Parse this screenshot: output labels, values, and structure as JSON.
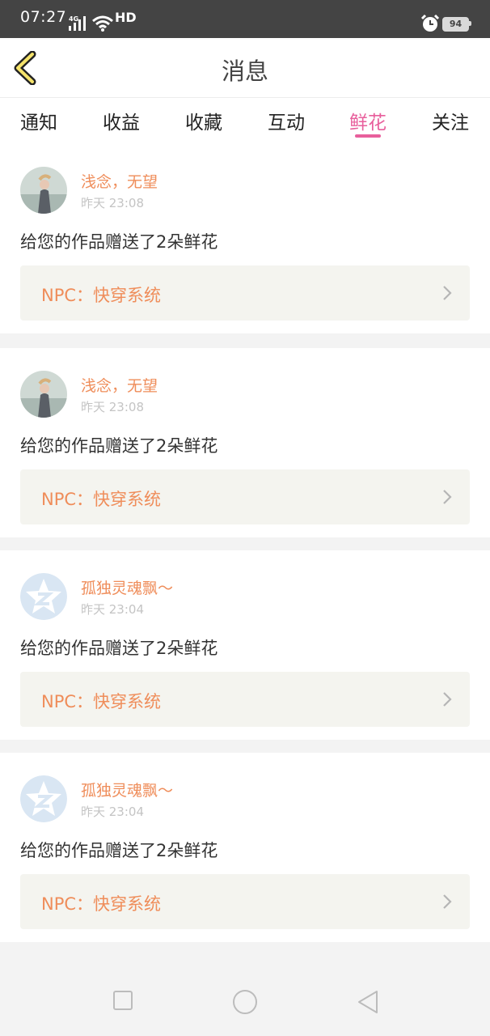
{
  "status_bar": {
    "time": "07:27",
    "network": "4G",
    "hd": "HD",
    "battery": "94"
  },
  "header": {
    "title": "消息",
    "back_icon": "chevron-left-icon"
  },
  "tabs": [
    {
      "label": "通知",
      "active": false
    },
    {
      "label": "收益",
      "active": false
    },
    {
      "label": "收藏",
      "active": false
    },
    {
      "label": "互动",
      "active": false
    },
    {
      "label": "鲜花",
      "active": true
    },
    {
      "label": "关注",
      "active": false
    }
  ],
  "messages": [
    {
      "user": "浅念，无望",
      "time": "昨天 23:08",
      "avatar": "photo-avatar",
      "text": "给您的作品赠送了2朵鲜花",
      "work": "NPC：快穿系统"
    },
    {
      "user": "浅念，无望",
      "time": "昨天 23:08",
      "avatar": "photo-avatar",
      "text": "给您的作品赠送了2朵鲜花",
      "work": "NPC：快穿系统"
    },
    {
      "user": "孤独灵魂飘〜",
      "time": "昨天 23:04",
      "avatar": "default-star-avatar",
      "text": "给您的作品赠送了2朵鲜花",
      "work": "NPC：快穿系统"
    },
    {
      "user": "孤独灵魂飘〜",
      "time": "昨天 23:04",
      "avatar": "default-star-avatar",
      "text": "给您的作品赠送了2朵鲜花",
      "work": "NPC：快穿系统"
    }
  ],
  "colors": {
    "accent": "#e85f9c",
    "username": "#ef8d5a",
    "status_bar": "#444444"
  },
  "nav_bar": {
    "icons": [
      "square-icon",
      "circle-icon",
      "triangle-back-icon"
    ]
  }
}
